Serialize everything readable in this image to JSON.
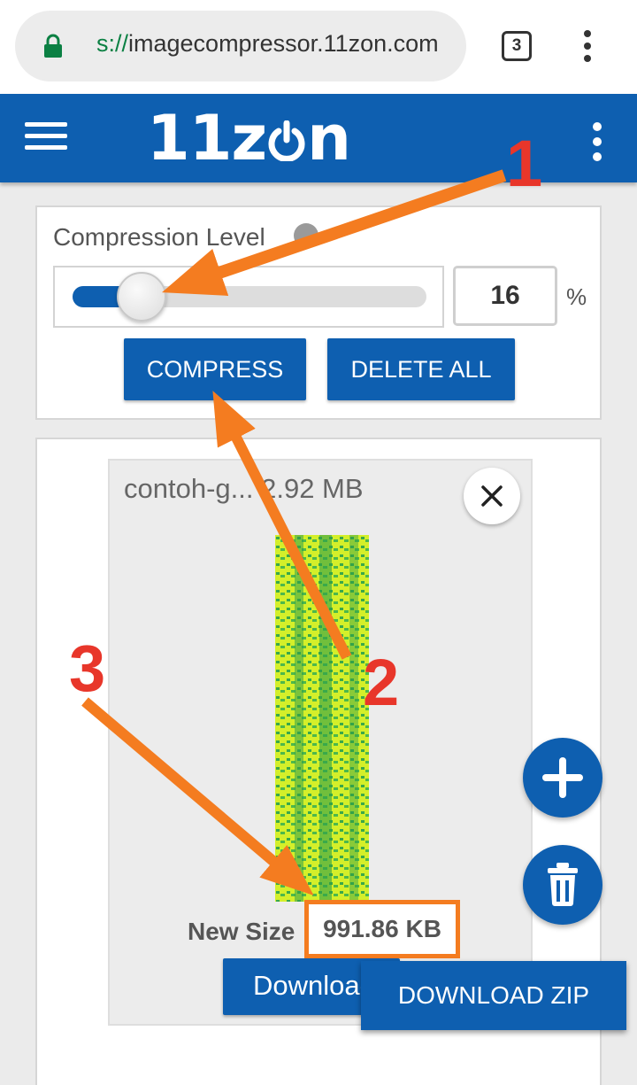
{
  "browser": {
    "url_scheme": "s://",
    "url_host": "imagecompressor.11zon.com",
    "tab_count": "3"
  },
  "header": {
    "logo_text": "11z",
    "logo_tail": "n",
    "brand_color": "#0e5fb0"
  },
  "compression": {
    "label": "Compression Level",
    "level_value": "16",
    "level_fraction": 0.16,
    "unit": "%",
    "compress_label": "COMPRESS",
    "delete_all_label": "DELETE ALL"
  },
  "file": {
    "name": "contoh-g...",
    "original_size": "2.92 MB",
    "new_size_label": "New Size",
    "new_size_value": "991.86 KB",
    "download_label": "Download"
  },
  "actions": {
    "download_zip_label": "DOWNLOAD ZIP"
  },
  "annotations": {
    "step_1": "1",
    "step_2": "2",
    "step_3": "3",
    "arrow_color": "#f47c20",
    "number_color": "#e8362a"
  }
}
